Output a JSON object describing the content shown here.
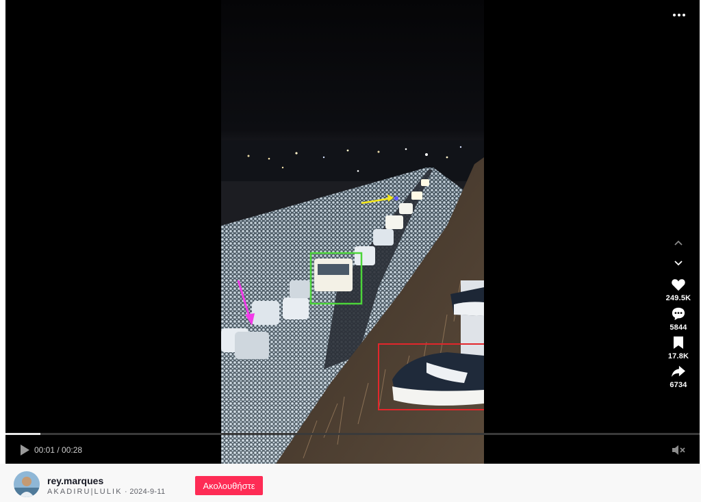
{
  "colors": {
    "follow_button": "#FE2C55",
    "annotation_yellow": "#F5E81A",
    "annotation_green": "#4CD53A",
    "annotation_magenta": "#F23AE8",
    "annotation_red": "#E3262B"
  },
  "player": {
    "more_icon": "ellipsis-icon",
    "progress_fraction": 0.05,
    "current_time": "00:01",
    "separator": " / ",
    "duration": "00:28",
    "play_icon": "play-icon",
    "mute_icon": "muted-speaker-icon"
  },
  "actions": {
    "nav_up_icon": "chevron-up-icon",
    "nav_down_icon": "chevron-down-icon",
    "like_count": "249.5K",
    "comment_count": "5844",
    "bookmark_count": "17.8K",
    "share_count": "6734"
  },
  "author": {
    "username": "rey.marques",
    "nickname": "AKADIRU|LULIK",
    "dot": " · ",
    "date": "2024-9-11",
    "follow_label": "Ακολουθήστε"
  }
}
